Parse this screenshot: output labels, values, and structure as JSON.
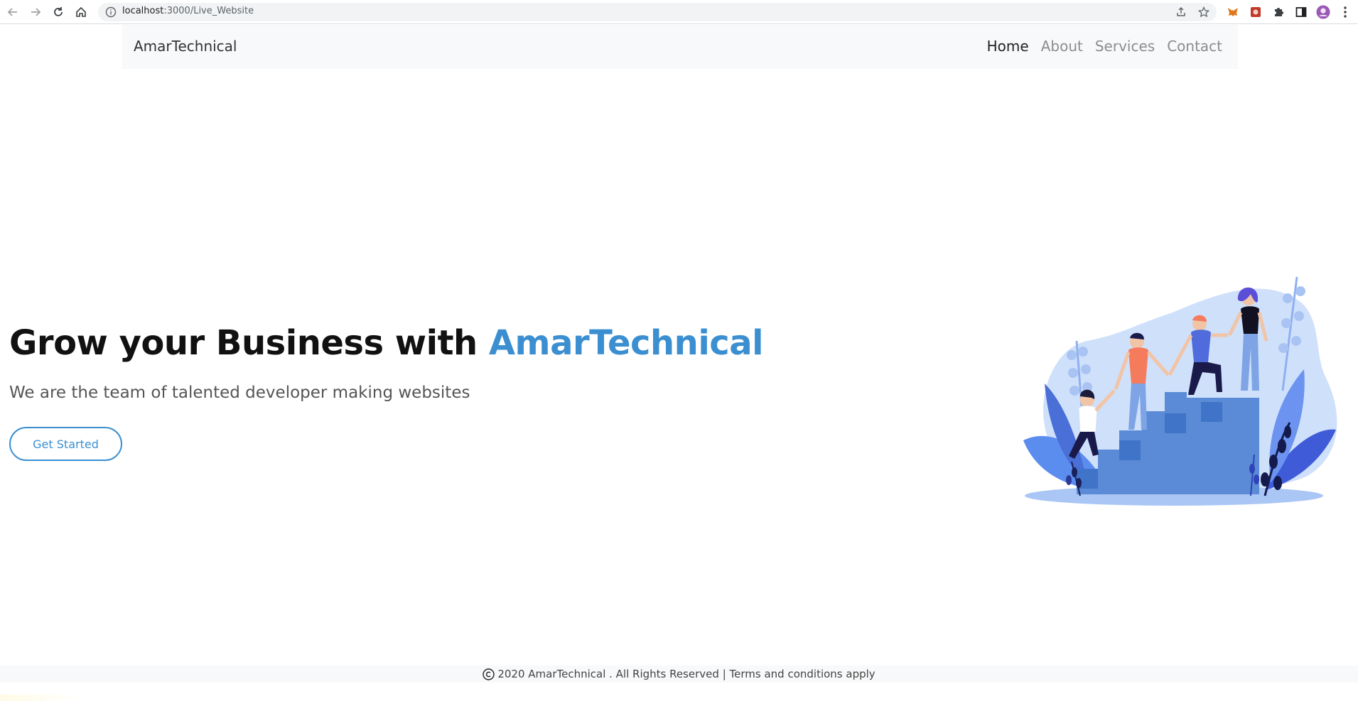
{
  "browser": {
    "url_host": "localhost",
    "url_path": ":3000/Live_Website",
    "icons": [
      "back-icon",
      "forward-icon",
      "reload-icon",
      "home-icon",
      "info-icon",
      "share-icon",
      "star-icon",
      "metamask-extension-icon",
      "extension-icon",
      "puzzle-icon",
      "side-panel-icon",
      "profile-avatar-icon",
      "menu-dots-icon"
    ]
  },
  "navbar": {
    "brand": "AmarTechnical",
    "links": [
      {
        "label": "Home",
        "active": true
      },
      {
        "label": "About",
        "active": false
      },
      {
        "label": "Services",
        "active": false
      },
      {
        "label": "Contact",
        "active": false
      }
    ]
  },
  "hero": {
    "title_prefix": "Grow your Business with ",
    "title_brand": "AmarTechnical",
    "subtitle": "We are the team of talented developer making websites",
    "cta_label": "Get Started"
  },
  "footer": {
    "text": "2020 AmarTechnical . All Rights Reserved | Terms and conditions apply"
  },
  "colors": {
    "accent": "#3b8fd1",
    "navbar_bg": "#f8f9fa",
    "text_dark": "#111111"
  }
}
